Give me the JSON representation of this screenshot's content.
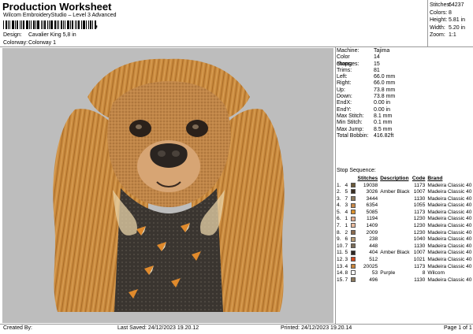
{
  "header": {
    "title": "Production Worksheet",
    "subtitle": "Wilcom EmbroideryStudio – Level 3 Advanced",
    "barcode_tail": ",",
    "design_label": "Design:",
    "design_value": "Cavalier King 5,8 in",
    "colorway_label": "Colorway:",
    "colorway_value": "Colorway 1"
  },
  "summary": [
    {
      "k": "Stitches:",
      "v": "64237"
    },
    {
      "k": "Colors:",
      "v": "8"
    },
    {
      "k": "Height:",
      "v": "5.81 in"
    },
    {
      "k": "Width:",
      "v": "5.20 in"
    },
    {
      "k": "Zoom:",
      "v": "1:1"
    }
  ],
  "properties": [
    {
      "k": "Machine:",
      "v": "Tajima"
    },
    {
      "k": "Color changes:",
      "v": "14"
    },
    {
      "k": "Stops:",
      "v": "15"
    },
    {
      "k": "Trims:",
      "v": "81"
    },
    {
      "k": "Left:",
      "v": "66.0 mm"
    },
    {
      "k": "Right:",
      "v": "66.0 mm"
    },
    {
      "k": "Up:",
      "v": "73.8 mm"
    },
    {
      "k": "Down:",
      "v": "73.8 mm"
    },
    {
      "k": "EndX:",
      "v": "0.00 in"
    },
    {
      "k": "EndY:",
      "v": "0.00 in"
    },
    {
      "k": "Max Stitch:",
      "v": "8.1 mm"
    },
    {
      "k": "Min Stitch:",
      "v": "0.1 mm"
    },
    {
      "k": "Max Jump:",
      "v": "8.5 mm"
    },
    {
      "k": "Total Bobbin:",
      "v": "416.82ft"
    }
  ],
  "sequence": {
    "title": "Stop Sequence:",
    "headers": {
      "stitches": "Stitches",
      "description": "Description",
      "code": "Code",
      "brand": "Brand"
    },
    "rows": [
      {
        "idx": "1.",
        "col": "4",
        "color": "#6b5a3a",
        "st": "19038",
        "desc": "",
        "code": "1173",
        "brand": "Madeira Classic 40"
      },
      {
        "idx": "2.",
        "col": "5",
        "color": "#3a2e22",
        "st": "3026",
        "desc": "Amber Black",
        "code": "1007",
        "brand": "Madeira Classic 40"
      },
      {
        "idx": "3.",
        "col": "7",
        "color": "#8c7a5e",
        "st": "3444",
        "desc": "",
        "code": "1130",
        "brand": "Madeira Classic 40"
      },
      {
        "idx": "4.",
        "col": "3",
        "color": "#c8894a",
        "st": "6354",
        "desc": "",
        "code": "1055",
        "brand": "Madeira Classic 40"
      },
      {
        "idx": "5.",
        "col": "4",
        "color": "#d9902e",
        "st": "5085",
        "desc": "",
        "code": "1173",
        "brand": "Madeira Classic 40"
      },
      {
        "idx": "6.",
        "col": "1",
        "color": "#e0a98a",
        "st": "1194",
        "desc": "",
        "code": "1230",
        "brand": "Madeira Classic 40"
      },
      {
        "idx": "7.",
        "col": "1",
        "color": "#e8b99c",
        "st": "1409",
        "desc": "",
        "code": "1230",
        "brand": "Madeira Classic 40"
      },
      {
        "idx": "8.",
        "col": "2",
        "color": "#8a6a4e",
        "st": "2009",
        "desc": "",
        "code": "1230",
        "brand": "Madeira Classic 40"
      },
      {
        "idx": "9.",
        "col": "6",
        "color": "#b79a72",
        "st": "238",
        "desc": "",
        "code": "1040",
        "brand": "Madeira Classic 40"
      },
      {
        "idx": "10.",
        "col": "7",
        "color": "#7c6d58",
        "st": "448",
        "desc": "",
        "code": "1130",
        "brand": "Madeira Classic 40"
      },
      {
        "idx": "11.",
        "col": "5",
        "color": "#2e2822",
        "st": "404",
        "desc": "Amber Black",
        "code": "1007",
        "brand": "Madeira Classic 40"
      },
      {
        "idx": "12.",
        "col": "3",
        "color": "#d0481e",
        "st": "512",
        "desc": "",
        "code": "1021",
        "brand": "Madeira Classic 40"
      },
      {
        "idx": "13.",
        "col": "4",
        "color": "#c9853a",
        "st": "20025",
        "desc": "",
        "code": "1173",
        "brand": "Madeira Classic 40"
      },
      {
        "idx": "14.",
        "col": "8",
        "color": "#ffffff",
        "st": "53",
        "desc": "Purple",
        "code": "8",
        "brand": "Wilcom"
      },
      {
        "idx": "15.",
        "col": "7",
        "color": "#8c7a5e",
        "st": "496",
        "desc": "",
        "code": "1130",
        "brand": "Madeira Classic 40"
      }
    ]
  },
  "footer": {
    "created_by": "Created By:",
    "last_saved": "Last Saved: 24/12/2023 19.20.12",
    "printed": "Printed: 24/12/2023 19.20.14",
    "page": "Page 1 of 1"
  },
  "colors": {
    "preview_bg": "#bdbdbd",
    "fur": "#c98a3e",
    "fur_dark": "#9a5e1f",
    "fur_light": "#e0a85e",
    "face": "#c08648",
    "chest": "#3a3530",
    "bandana_accent": "#e08a2c"
  },
  "preview": {
    "image": "embroidery-dog-cavalier-king"
  }
}
